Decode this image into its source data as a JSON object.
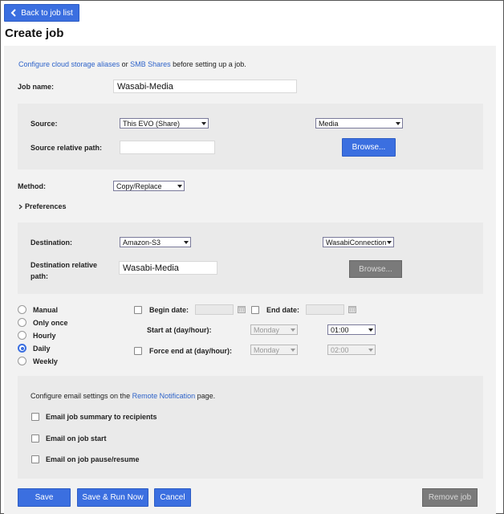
{
  "nav": {
    "back_label": "Back to job list"
  },
  "page": {
    "title": "Create job"
  },
  "intro": {
    "link1": "Configure cloud storage aliases",
    "mid": "or",
    "link2": "SMB Shares",
    "tail": "before setting up a job."
  },
  "job_name": {
    "label": "Job name:",
    "value": "Wasabi-Media"
  },
  "source": {
    "label": "Source:",
    "select1": "This EVO (Share)",
    "select2": "Media",
    "path_label": "Source relative path:",
    "path_value": "",
    "browse_label": "Browse..."
  },
  "method": {
    "label": "Method:",
    "value": "Copy/Replace"
  },
  "preferences": {
    "label": "Preferences"
  },
  "destination": {
    "label": "Destination:",
    "select1": "Amazon-S3",
    "select2": "WasabiConnection",
    "path_label_line1": "Destination relative",
    "path_label_line2": "path:",
    "path_value": "Wasabi-Media",
    "browse_label": "Browse..."
  },
  "schedule": {
    "options": [
      "Manual",
      "Only once",
      "Hourly",
      "Daily",
      "Weekly"
    ],
    "selected": "Daily",
    "begin_date_label": "Begin date:",
    "end_date_label": "End date:",
    "start_label": "Start at (day/hour):",
    "start_day": "Monday",
    "start_hour": "01:00",
    "force_end_label": "Force end at (day/hour):",
    "force_day": "Monday",
    "force_hour": "02:00"
  },
  "email": {
    "intro_pre": "Configure email settings on the",
    "intro_link": "Remote Notification",
    "intro_post": "page.",
    "opt1": "Email job summary to recipients",
    "opt2": "Email on job start",
    "opt3": "Email on job pause/resume"
  },
  "actions": {
    "save": "Save",
    "save_run": "Save & Run Now",
    "cancel": "Cancel",
    "remove": "Remove job"
  },
  "colors": {
    "accent": "#3b6fe0",
    "panel": "#eaeaea",
    "link": "#2e63c9"
  }
}
